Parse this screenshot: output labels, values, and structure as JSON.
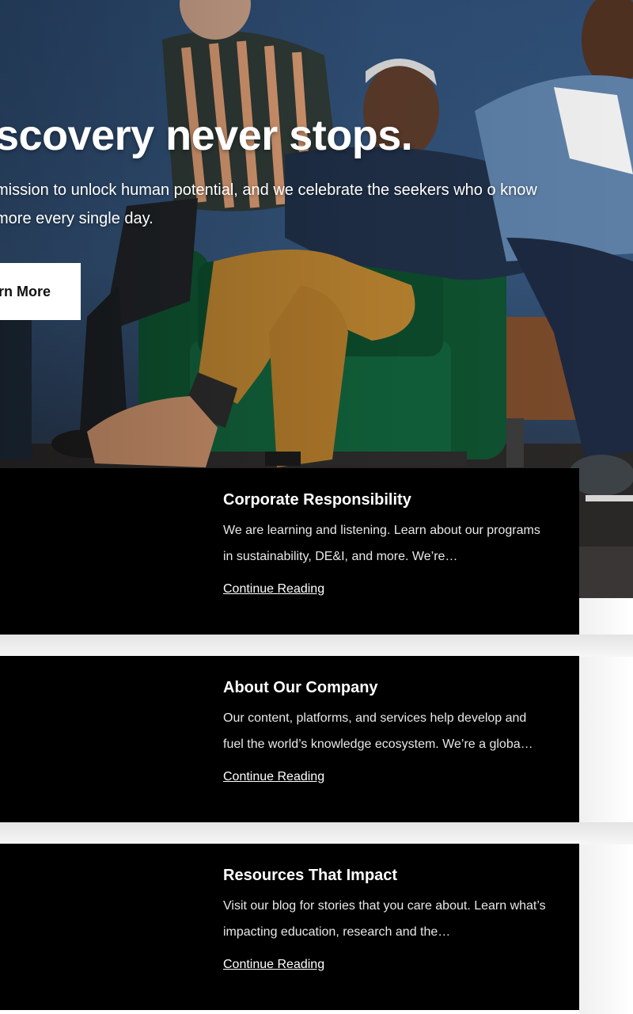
{
  "hero": {
    "title": "scovery never stops.",
    "text": "mission to unlock human potential, and we celebrate the seekers who o know more every single day.",
    "button_label": "rn More"
  },
  "cards": [
    {
      "title": "Corporate Responsibility",
      "description": "We are learning and listening. Learn about our programs in sustainability, DE&I, and more. We’re…",
      "link": "Continue Reading"
    },
    {
      "title": "About Our Company",
      "description": "Our content, platforms, and services help develop and fuel the world’s knowledge ecosystem. We’re a globa…",
      "link": "Continue Reading"
    },
    {
      "title": "Resources That Impact",
      "description": "Visit our blog for stories that you care about. Learn what’s impacting education, research and the…",
      "link": "Continue Reading"
    }
  ],
  "colors": {
    "card_background": "#000000",
    "hero_wall": "#2e4d74",
    "sofa_green": "#0f5a34",
    "trousers_mustard": "#b7812f"
  }
}
